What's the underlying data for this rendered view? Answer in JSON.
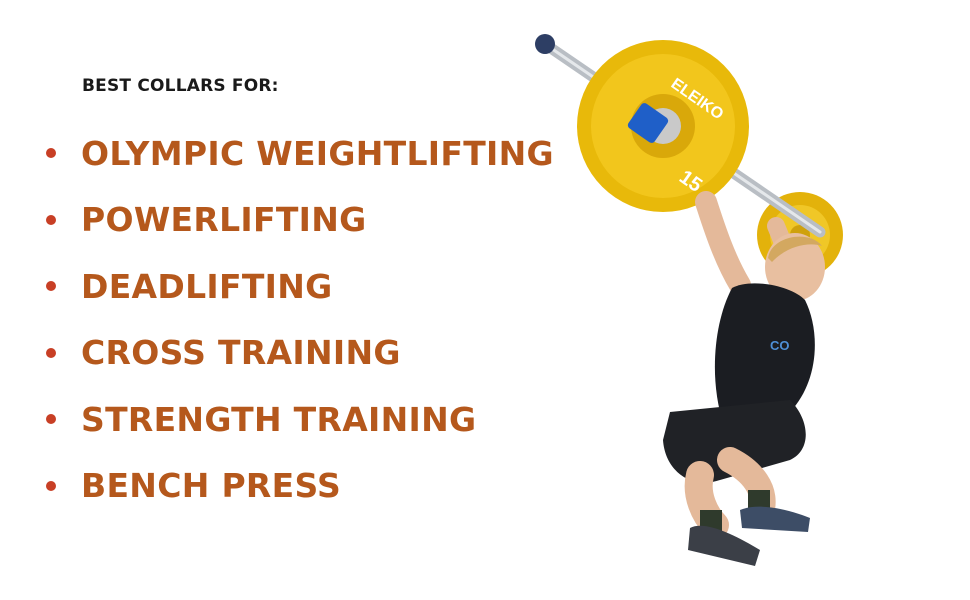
{
  "heading": "BEST COLLARS FOR:",
  "items": [
    {
      "label": "OLYMPIC WEIGHTLIFTING"
    },
    {
      "label": "POWERLIFTING"
    },
    {
      "label": "DEADLIFTING"
    },
    {
      "label": "CROSS TRAINING"
    },
    {
      "label": "STRENGTH TRAINING"
    },
    {
      "label": "BENCH PRESS"
    }
  ],
  "plate": {
    "brand": "ELEIKO",
    "weight": "15"
  },
  "colors": {
    "heading": "#1a1a1a",
    "label": "#b5581c",
    "bullet": "#c83f25",
    "plate": "#e8b90a",
    "collar": "#1f5fc8"
  }
}
